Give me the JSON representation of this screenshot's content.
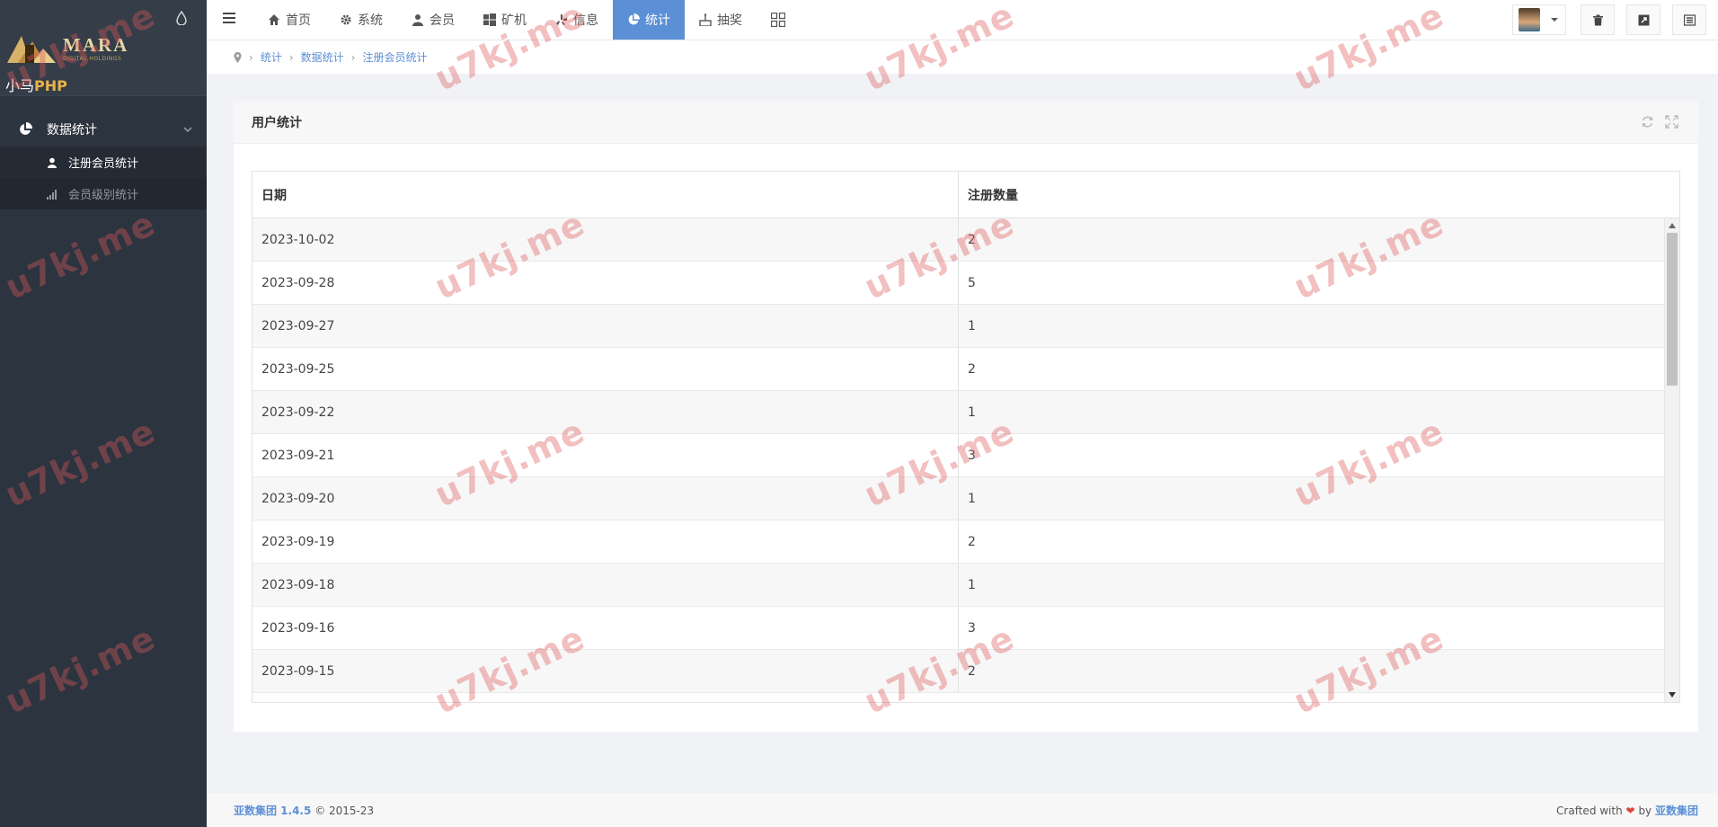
{
  "sidebar": {
    "logo_text": "MARA",
    "logo_sub": "DIGITAL HOLDINGS",
    "logo_php_prefix": "小马",
    "logo_php_suffix": "PHP",
    "nav_parent": "数据统计",
    "nav_children": [
      "注册会员统计",
      "会员级别统计"
    ]
  },
  "topbar": {
    "items": [
      "首页",
      "系统",
      "会员",
      "矿机",
      "信息",
      "统计",
      "抽奖"
    ]
  },
  "breadcrumb": [
    "统计",
    "数据统计",
    "注册会员统计"
  ],
  "panel": {
    "title": "用户统计",
    "columns": [
      "日期",
      "注册数量"
    ],
    "rows": [
      [
        "2023-10-02",
        "2"
      ],
      [
        "2023-09-28",
        "5"
      ],
      [
        "2023-09-27",
        "1"
      ],
      [
        "2023-09-25",
        "2"
      ],
      [
        "2023-09-22",
        "1"
      ],
      [
        "2023-09-21",
        "3"
      ],
      [
        "2023-09-20",
        "1"
      ],
      [
        "2023-09-19",
        "2"
      ],
      [
        "2023-09-18",
        "1"
      ],
      [
        "2023-09-16",
        "3"
      ],
      [
        "2023-09-15",
        "2"
      ]
    ]
  },
  "footer": {
    "brand": "亚数集团 1.4.5",
    "copyright": "© 2015-23",
    "crafted": "Crafted with",
    "by": "by",
    "author": "亚数集团"
  },
  "watermark": "u7kj.me",
  "colors": {
    "sidebar_bg": "#2c343f",
    "accent": "#5b8fd6",
    "watermark": "#dc5a5a"
  }
}
